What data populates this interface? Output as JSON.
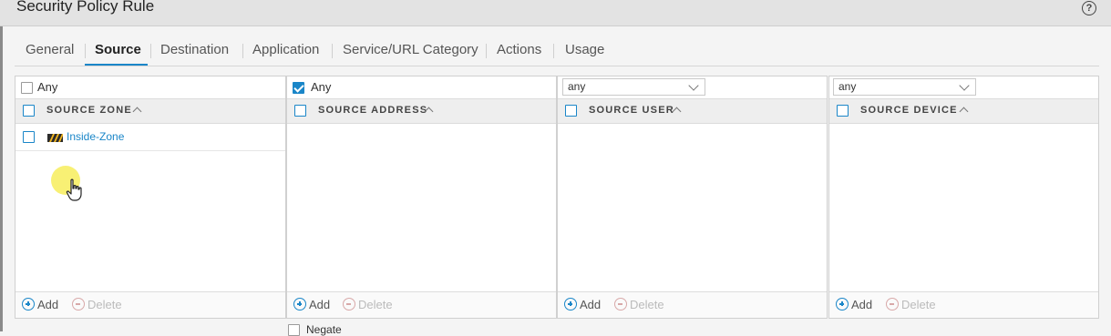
{
  "window": {
    "title": "Security Policy Rule",
    "help_icon": "?"
  },
  "tabs": [
    {
      "label": "General",
      "active": false
    },
    {
      "label": "Source",
      "active": true
    },
    {
      "label": "Destination",
      "active": false
    },
    {
      "label": "Application",
      "active": false
    },
    {
      "label": "Service/URL Category",
      "active": false
    },
    {
      "label": "Actions",
      "active": false
    },
    {
      "label": "Usage",
      "active": false
    }
  ],
  "panels": {
    "source_zone": {
      "any_label": "Any",
      "any_checked": false,
      "header": "SOURCE ZONE",
      "rows": [
        "Inside-Zone"
      ],
      "add_label": "Add",
      "delete_label": "Delete"
    },
    "source_address": {
      "any_label": "Any",
      "any_checked": true,
      "header": "SOURCE ADDRESS",
      "add_label": "Add",
      "delete_label": "Delete"
    },
    "source_user": {
      "select_value": "any",
      "header": "SOURCE USER",
      "add_label": "Add",
      "delete_label": "Delete"
    },
    "source_device": {
      "select_value": "any",
      "header": "SOURCE DEVICE",
      "add_label": "Add",
      "delete_label": "Delete"
    }
  },
  "negate": {
    "label": "Negate",
    "checked": false
  },
  "colors": {
    "accent": "#1a86c8",
    "cursor_highlight": "#f5eb46"
  }
}
